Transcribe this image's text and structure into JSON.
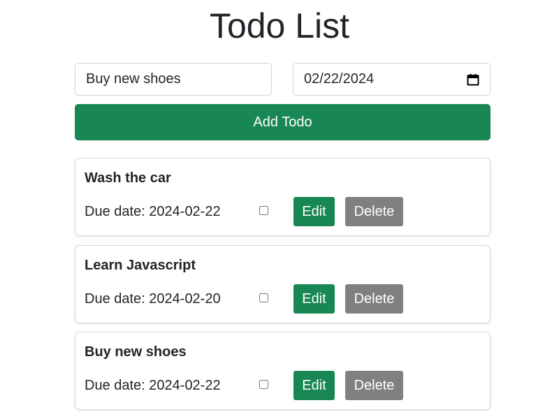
{
  "colors": {
    "primary_green": "#198754",
    "delete_gray": "#808080",
    "text": "#212529"
  },
  "header": {
    "title": "Todo List"
  },
  "form": {
    "todo_text_value": "Buy new shoes",
    "date_value": "02/22/2024",
    "date_icon": "calendar-icon",
    "add_button_label": "Add Todo"
  },
  "todos": [
    {
      "title": "Wash the car",
      "due": "Due date: 2024-02-22",
      "completed": false,
      "edit_label": "Edit",
      "delete_label": "Delete"
    },
    {
      "title": "Learn Javascript",
      "due": "Due date: 2024-02-20",
      "completed": false,
      "edit_label": "Edit",
      "delete_label": "Delete"
    },
    {
      "title": "Buy new shoes",
      "due": "Due date: 2024-02-22",
      "completed": false,
      "edit_label": "Edit",
      "delete_label": "Delete"
    }
  ]
}
